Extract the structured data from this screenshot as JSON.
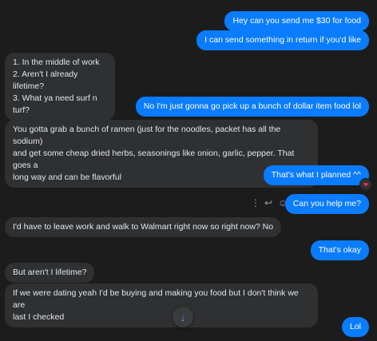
{
  "colors": {
    "background": "#1c1c1d",
    "outgoing": "#0a7cff",
    "incoming": "#2f3031",
    "text_light": "#e4e6eb"
  },
  "messages": [
    {
      "from": "me",
      "text": "Hey can you send me $30 for food"
    },
    {
      "from": "me",
      "text": "I can send something in return if you'd like"
    },
    {
      "from": "them",
      "lines": [
        "1. In the middle of work",
        "2. Aren't I already lifetime?",
        "3. What ya need surf n turf?"
      ]
    },
    {
      "from": "me",
      "text": "No I'm just gonna go pick up a bunch of dollar item food lol"
    },
    {
      "from": "them",
      "lines": [
        "You gotta grab a bunch of ramen (just for the noodles, packet has all the sodium)",
        "and get some cheap dried herbs, seasonings like onion, garlic, pepper. That goes a",
        "long way and can be flavorful"
      ]
    },
    {
      "from": "me",
      "text": "That's what I planned ^^",
      "reaction": "heart-icon"
    },
    {
      "from": "me",
      "text": "Can you help me?"
    },
    {
      "from": "them",
      "text": "I'd have to leave work and walk to Walmart right now so right now? No"
    },
    {
      "from": "me",
      "text": "That's okay"
    },
    {
      "from": "them",
      "text": "But aren't I lifetime?"
    },
    {
      "from": "them",
      "lines": [
        "If we were dating yeah I'd be buying and making you food but I don't think we are",
        "last I checked"
      ]
    },
    {
      "from": "me",
      "text": "Lol"
    }
  ],
  "hover_actions": {
    "more": "⋮",
    "reply": "↩",
    "react": "☺"
  },
  "scroll_button": {
    "icon": "arrow-down-icon",
    "glyph": "↓"
  },
  "reaction_glyph": "❤"
}
